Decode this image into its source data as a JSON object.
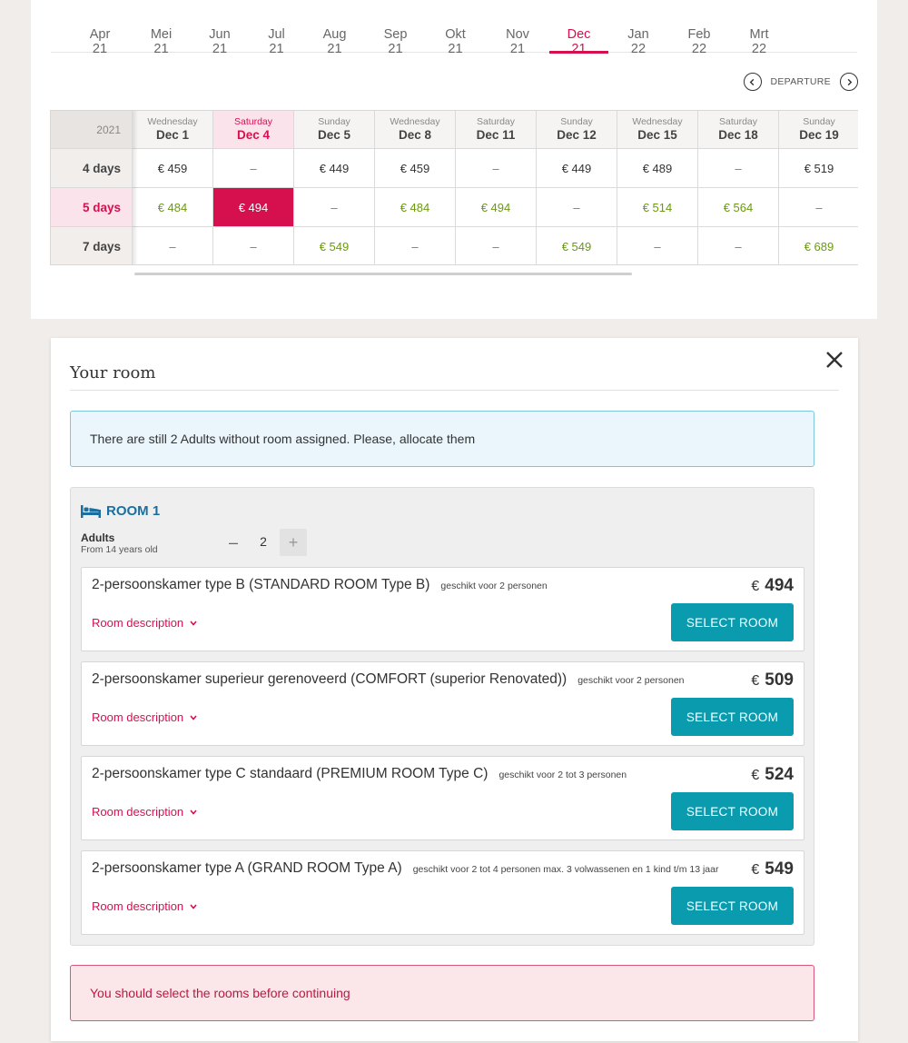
{
  "months": {
    "items": [
      "Apr 21",
      "Mei 21",
      "Jun 21",
      "Jul 21",
      "Aug 21",
      "Sep 21",
      "Okt 21",
      "Nov 21",
      "Dec 21",
      "Jan 22",
      "Feb 22",
      "Mrt 22"
    ],
    "active": "Dec 21"
  },
  "departure": {
    "label": "DEPARTURE"
  },
  "grid": {
    "year": "2021",
    "columns": [
      {
        "weekday": "Wednesday",
        "date": "Dec 1"
      },
      {
        "weekday": "Saturday",
        "date": "Dec 4"
      },
      {
        "weekday": "Sunday",
        "date": "Dec 5"
      },
      {
        "weekday": "Wednesday",
        "date": "Dec 8"
      },
      {
        "weekday": "Saturday",
        "date": "Dec 11"
      },
      {
        "weekday": "Sunday",
        "date": "Dec 12"
      },
      {
        "weekday": "Wednesday",
        "date": "Dec 15"
      },
      {
        "weekday": "Saturday",
        "date": "Dec 18"
      },
      {
        "weekday": "Sunday",
        "date": "Dec 19"
      }
    ],
    "selected_column": 1,
    "selected_row": 1,
    "rows": [
      {
        "label": "4 days",
        "prices": [
          "€ 459",
          "–",
          "€ 449",
          "€ 459",
          "–",
          "€ 449",
          "€ 489",
          "–",
          "€ 519"
        ],
        "style": "normal"
      },
      {
        "label": "5 days",
        "prices": [
          "€ 484",
          "€ 494",
          "–",
          "€ 484",
          "€ 494",
          "–",
          "€ 514",
          "€ 564",
          "–"
        ],
        "style": "green"
      },
      {
        "label": "7 days",
        "prices": [
          "–",
          "–",
          "€ 549",
          "–",
          "–",
          "€ 549",
          "–",
          "–",
          "€ 689"
        ],
        "style": "green"
      }
    ]
  },
  "modal": {
    "title": "Your room",
    "info": "There are still 2 Adults without room assigned. Please, allocate them",
    "warning": "You should select the rooms before continuing"
  },
  "room": {
    "title": "ROOM 1",
    "adults_label": "Adults",
    "adults_sub": "From 14 years old",
    "adults_value": "2",
    "minus": "–",
    "plus": "+"
  },
  "rooms": [
    {
      "name": "2-persoonskamer type B (STANDARD ROOM Type B)",
      "capacity": "geschikt voor 2 personen",
      "currency": "€",
      "price": "494",
      "desc": "Room description",
      "button": "SELECT ROOM"
    },
    {
      "name": "2-persoonskamer superieur gerenoveerd (COMFORT (superior Renovated))",
      "capacity": "geschikt voor 2 personen",
      "currency": "€",
      "price": "509",
      "desc": "Room description",
      "button": "SELECT ROOM"
    },
    {
      "name": "2-persoonskamer type C standaard (PREMIUM ROOM Type C)",
      "capacity": "geschikt voor 2 tot 3 personen",
      "currency": "€",
      "price": "524",
      "desc": "Room description",
      "button": "SELECT ROOM"
    },
    {
      "name": "2-persoonskamer type A (GRAND ROOM Type A)",
      "capacity": "geschikt voor 2 tot 4 personen max. 3 volwassenen en 1 kind t/m 13 jaar",
      "currency": "€",
      "price": "549",
      "desc": "Room description",
      "button": "SELECT ROOM"
    }
  ],
  "colors": {
    "accent": "#d6104f",
    "primary_button": "#0a9cae",
    "green_price": "#6a9a10",
    "room_title": "#1a6fa0"
  }
}
